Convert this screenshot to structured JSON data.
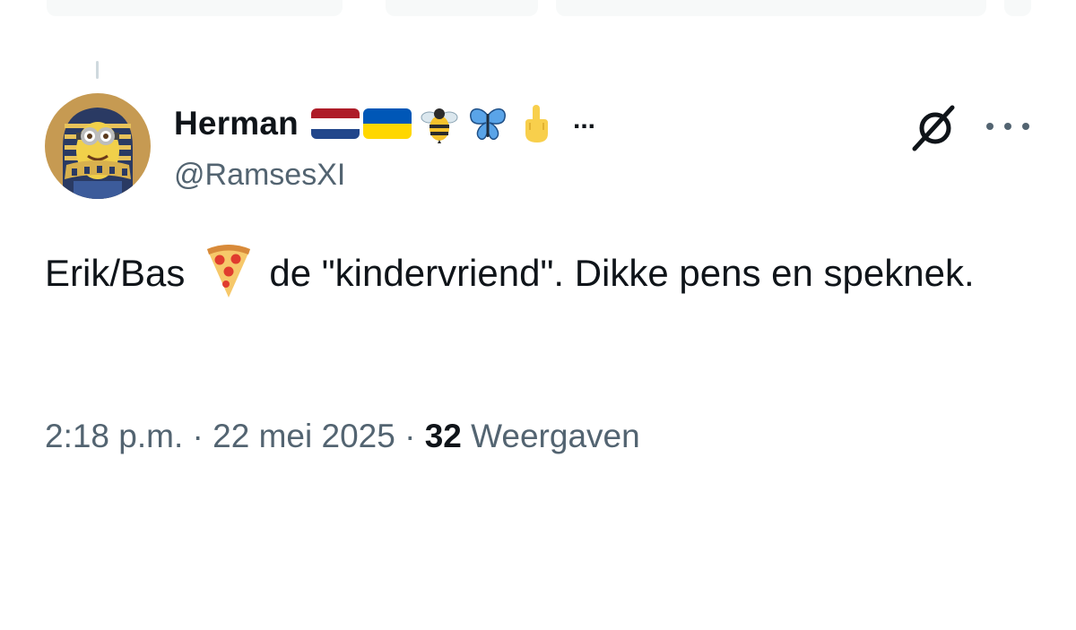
{
  "author": {
    "display_name": "Herman",
    "name_ellipsis": "...",
    "handle": "@RamsesXI",
    "name_icons": [
      "netherlands-flag-icon",
      "ukraine-flag-icon",
      "bee-icon",
      "butterfly-icon",
      "middle-finger-icon"
    ]
  },
  "actions": {
    "grok_icon": "grok-icon",
    "more_icon": "more-icon"
  },
  "tweet": {
    "text_before": "Erik/Bas",
    "emoji": "pizza-icon",
    "text_after": "de \"kindervriend\". Dikke pens en speknek."
  },
  "meta": {
    "time": "2:18 p.m.",
    "sep1": " · ",
    "date": "22 mei 2025",
    "sep2": " · ",
    "views_count": "32",
    "views_label": " Weergaven"
  },
  "colors": {
    "text": "#0f1419",
    "secondary": "#536471",
    "background": "#ffffff"
  }
}
